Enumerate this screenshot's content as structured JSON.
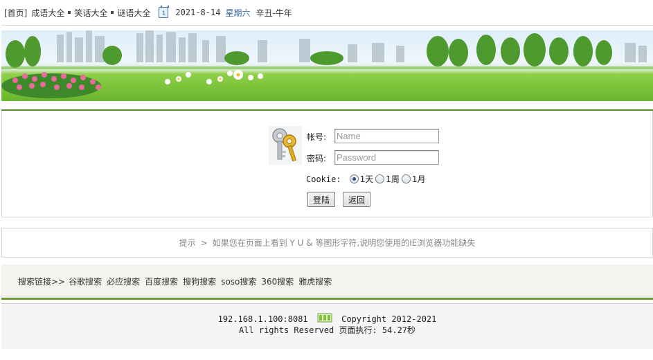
{
  "nav": {
    "home": "[首页]",
    "idioms": "成语大全",
    "jokes": "笑话大全",
    "riddles": "谜语大全",
    "date": "2021-8-14",
    "weekday": "星期六",
    "lunar": "辛丑-牛年",
    "calendar_day": "1"
  },
  "login": {
    "account_label": "帐号:",
    "account_placeholder": "Name",
    "password_label": "密码:",
    "password_placeholder": "Password",
    "cookie_label": "Cookie:",
    "cookie_options": [
      "1天",
      "1周",
      "1月"
    ],
    "cookie_selected": "1天",
    "login_button": "登陆",
    "back_button": "返回"
  },
  "tip": {
    "label": "提示",
    "arrow": ">",
    "text": "如果您在页面上看到 Y U & 等图形字符,说明您使用的IE浏览器功能缺失"
  },
  "search": {
    "lead": "搜索链接>>",
    "links": [
      "谷歌搜索",
      "必应搜索",
      "百度搜索",
      "搜狗搜索",
      "soso搜索",
      "360搜索",
      "雅虎搜索"
    ]
  },
  "footer": {
    "address": "192.168.1.100:8081",
    "copyright": "Copyright 2012-2021",
    "rights": "All rights Reserved 页面执行: 54.27秒"
  },
  "colors": {
    "accent_blue": "#3a6ea5",
    "green_line": "#6b9a3a",
    "grass": "#7cc43a"
  }
}
